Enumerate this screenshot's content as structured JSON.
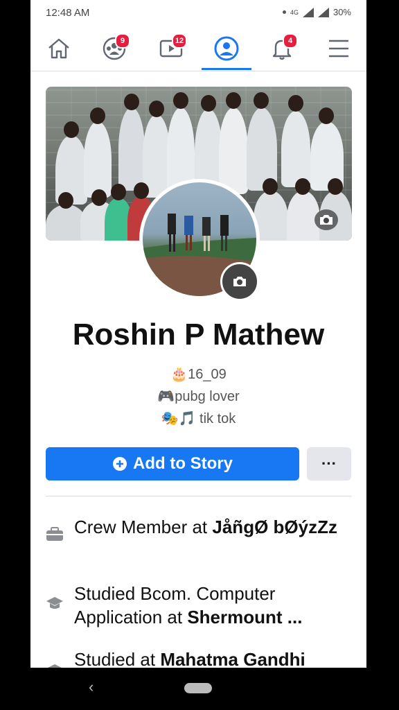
{
  "status_bar": {
    "time": "12:48 AM",
    "network": "4G",
    "battery": "30%"
  },
  "nav": {
    "items": [
      {
        "name": "home",
        "badge": ""
      },
      {
        "name": "groups",
        "badge": "9"
      },
      {
        "name": "watch",
        "badge": "12"
      },
      {
        "name": "profile",
        "badge": ""
      },
      {
        "name": "notifications",
        "badge": "4"
      },
      {
        "name": "menu",
        "badge": ""
      }
    ],
    "active": "profile",
    "accent_color": "#1877f2"
  },
  "profile": {
    "name": "Roshin P Mathew",
    "bio": [
      {
        "emoji": "🎂",
        "text": "16_09"
      },
      {
        "emoji": "🎮",
        "text": "pubg lover"
      },
      {
        "emoji": "🎭🎵",
        "text": " tik tok"
      }
    ]
  },
  "actions": {
    "add_story_label": "Add to Story",
    "more_label": "···"
  },
  "intro": [
    {
      "icon": "briefcase-icon",
      "prefix": "Crew Member at ",
      "bold": "JåñgØ bØýzZz"
    },
    {
      "icon": "graduation-cap-icon",
      "prefix": "Studied Bcom. Computer Application at ",
      "bold": "Shermount ..."
    },
    {
      "icon": "graduation-cap-icon",
      "prefix": "Studied at ",
      "bold": "Mahatma Gandhi"
    }
  ]
}
